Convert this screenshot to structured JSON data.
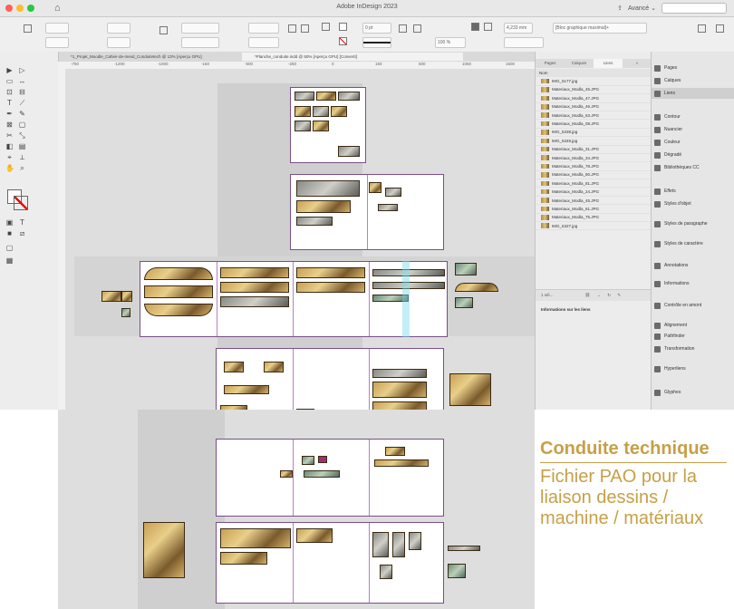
{
  "window": {
    "title": "Adobe InDesign 2023",
    "share_label": "Avancé ⌄"
  },
  "control_bar": {
    "stroke_weight": "0 pt",
    "zoom": "100 %",
    "width_value": "4,233 mm",
    "style_dropdown": "[Bloc graphique maximal]+"
  },
  "doc_tabs": [
    {
      "label": "*1_Projet_Moodle_Cahier-de-mesd_Conduitetech @ 13% [Aperçu GPU]"
    },
    {
      "label": "*Planche_conduite.indd @ 50% [Aperçu GPU] [Converti]"
    }
  ],
  "ruler": {
    "ticks": [
      "-750",
      "-1200",
      "-1000",
      "-150",
      "-500",
      "-250",
      "0",
      "150",
      "500",
      "1050",
      "1500"
    ]
  },
  "layers_panel": {
    "tabs": [
      "Pages",
      "Calques",
      "Liens",
      "»"
    ],
    "active_tab": "Liens",
    "header": "Nom",
    "items": [
      "IMG_5177.jpg",
      "Materiaux_Modla_45.JPG",
      "Materiaux_Modla_47.JPG",
      "Materiaux_Modla_46.JPG",
      "Materiaux_Modla_63.JPG",
      "Materiaux_Modla_08.JPG",
      "IMG_5338.jpg",
      "IMG_5349.jpg",
      "Materiaux_Modla_31.JPG",
      "Materiaux_Modla_34.JPG",
      "Materiaux_Modla_78.JPG",
      "Materiaux_Modla_80.JPG",
      "Materiaux_Modla_81.JPG",
      "Materiaux_Modla_24.JPG",
      "Materiaux_Modla_45.JPG",
      "Materiaux_Modla_61.JPG",
      "Materiaux_Modla_75.JPG",
      "IMG_6327.jpg"
    ],
    "footer_count": "1 sél...",
    "info_title": "Informations sur les liens"
  },
  "dock": {
    "items": [
      "Pages",
      "Calques",
      "Liens",
      "Contour",
      "Nuancier",
      "Couleur",
      "Dégradé",
      "Bibliothèques CC",
      "Effets",
      "Styles d'objet",
      "Styles de paragraphe",
      "Styles de caractère",
      "Annotations",
      "Informations",
      "Contrôle en amont",
      "Alignement",
      "Pathfinder",
      "Transformation",
      "Hyperliens",
      "Glyphes"
    ]
  },
  "caption": {
    "title": "Conduite technique",
    "body": "Fichier PAO pour la liaison dessins / machine / matériaux"
  }
}
